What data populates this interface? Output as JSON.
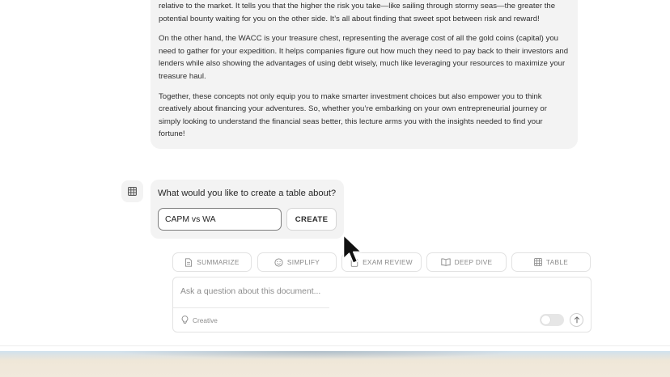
{
  "message": {
    "paragraphs": [
      "relative to the market. It tells you that the higher the risk you take—like sailing through stormy seas—the greater the potential bounty waiting for you on the other side. It’s all about finding that sweet spot between risk and reward!",
      "On the other hand, the WACC is your treasure chest, representing the average cost of all the gold coins (capital) you need to gather for your expedition. It helps companies figure out how much they need to pay back to their investors and lenders while also showing the advantages of using debt wisely, much like leveraging your resources to maximize your treasure haul.",
      "Together, these concepts not only equip you to make smarter investment choices but also empower you to think creatively about financing your adventures. So, whether you’re embarking on your own entrepreneurial journey or simply looking to understand the financial seas better, this lecture arms you with the insights needed to find your fortune!"
    ]
  },
  "table_prompt": {
    "icon": "table-icon",
    "question": "What would you like to create a table about?",
    "input_value": "CAPM vs WA",
    "create_label": "CREATE"
  },
  "actions": [
    {
      "icon": "document-icon",
      "label": "SUMMARIZE"
    },
    {
      "icon": "smiley-icon",
      "label": "SIMPLIFY"
    },
    {
      "icon": "exam-icon",
      "label": "EXAM REVIEW"
    },
    {
      "icon": "open-book-icon",
      "label": "DEEP DIVE"
    },
    {
      "icon": "table-icon",
      "label": "TABLE"
    }
  ],
  "ask": {
    "placeholder": "Ask a question about this document...",
    "creative_label": "Creative",
    "creative_icon": "lightbulb-icon",
    "creative_enabled": false,
    "send_icon": "arrow-up-icon"
  },
  "colors": {
    "bubble_bg": "#f3f3f3",
    "input_border": "#7d7d7d",
    "chip_text": "#8a8a8a",
    "bottom_band": "#f1e9dc"
  }
}
